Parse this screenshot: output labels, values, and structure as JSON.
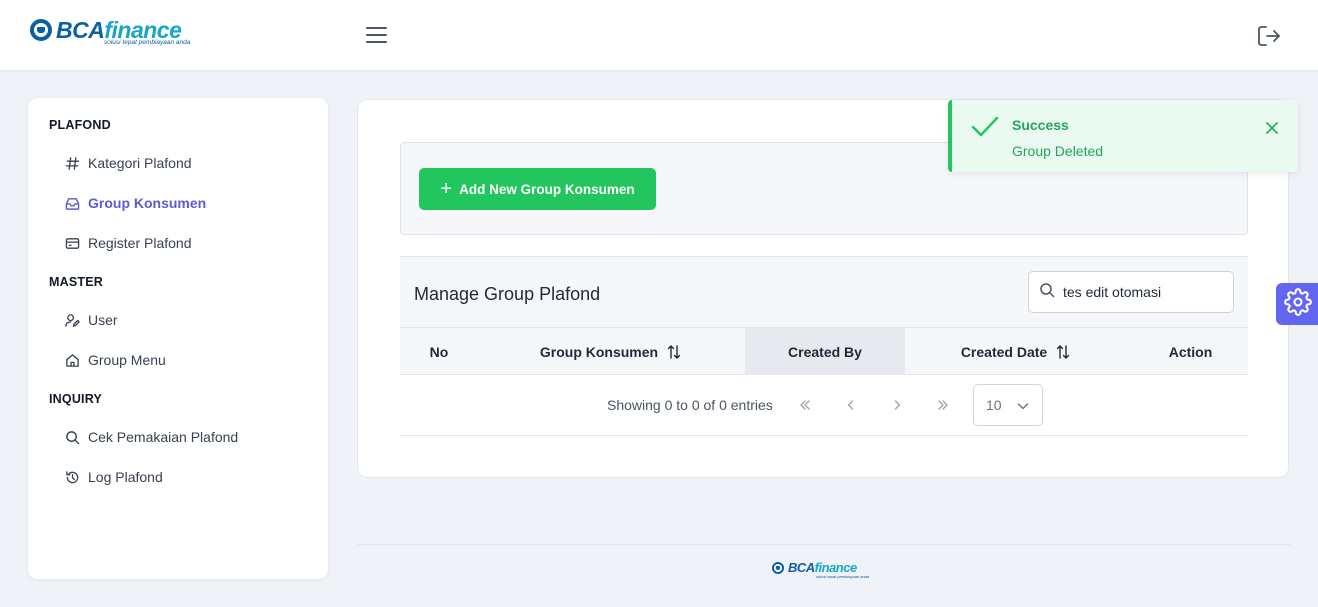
{
  "header": {
    "logo_bca": "BCA",
    "logo_finance": "finance",
    "logo_tagline": "solusi tepat pembiayaan anda"
  },
  "sidebar": {
    "sections": [
      {
        "title": "PLAFOND",
        "items": [
          {
            "label": "Kategori Plafond",
            "icon": "hash-icon"
          },
          {
            "label": "Group Konsumen",
            "icon": "inbox-icon",
            "active": true
          },
          {
            "label": "Register Plafond",
            "icon": "card-icon"
          }
        ]
      },
      {
        "title": "MASTER",
        "items": [
          {
            "label": "User",
            "icon": "user-edit-icon"
          },
          {
            "label": "Group Menu",
            "icon": "home-icon"
          }
        ]
      },
      {
        "title": "INQUIRY",
        "items": [
          {
            "label": "Cek Pemakaian Plafond",
            "icon": "search-icon"
          },
          {
            "label": "Log Plafond",
            "icon": "history-icon"
          }
        ]
      }
    ]
  },
  "main": {
    "add_button": "Add New Group Konsumen",
    "table_title": "Manage Group Plafond",
    "search": {
      "value": "tes edit otomasi",
      "placeholder": ""
    },
    "columns": [
      "No",
      "Group Konsumen",
      "Created By",
      "Created Date",
      "Action"
    ],
    "rows": [],
    "pagination": {
      "info": "Showing 0 to 0 of 0 entries",
      "first": "«",
      "prev": "‹",
      "next": "›",
      "last": "»",
      "page_size": "10"
    }
  },
  "toast": {
    "title": "Success",
    "message": "Group Deleted"
  },
  "footer": {
    "logo_bca": "BCA",
    "logo_finance": "finance",
    "logo_tagline": "solusi tepat pembiayaan anda"
  },
  "colors": {
    "accent": "#6366f1",
    "success": "#22c55e",
    "active_nav": "#5b5bd6",
    "brand_blue": "#0b5fa5"
  }
}
